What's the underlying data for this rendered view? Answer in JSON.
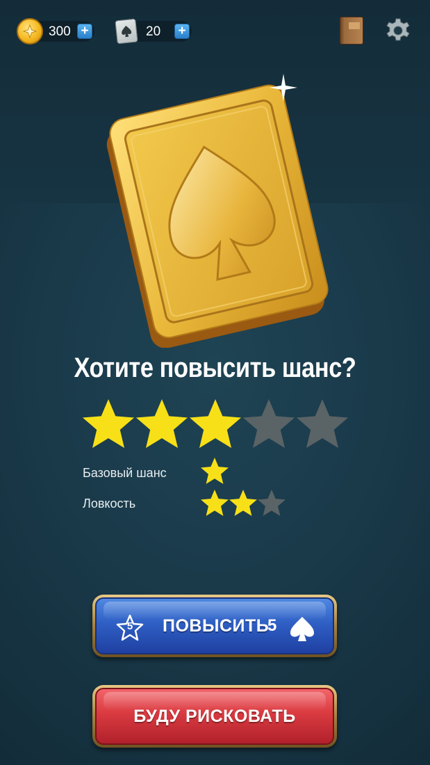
{
  "header": {
    "coins": "300",
    "cards": "20",
    "coin_plus_label": "+",
    "card_plus_label": "+"
  },
  "dialog": {
    "title": "Хотите повысить шанс?",
    "total_rating": {
      "filled": 3,
      "max": 5
    },
    "stats": [
      {
        "label": "Базовый шанс",
        "filled": 1,
        "max": 1
      },
      {
        "label": "Ловкость",
        "filled": 2,
        "max": 3
      }
    ]
  },
  "buttons": {
    "upgrade": {
      "label": "ПОВЫСИТЬ",
      "star_cost": "5",
      "price": "5",
      "price_icon": "spade-icon"
    },
    "risk": {
      "label": "БУДУ РИСКОВАТЬ"
    }
  },
  "colors": {
    "star_filled": "#f7e017",
    "star_empty": "#5a6366",
    "upgrade_button": "#2f5fc4",
    "risk_button": "#d93a40",
    "card_gold": "#e6b93a"
  }
}
